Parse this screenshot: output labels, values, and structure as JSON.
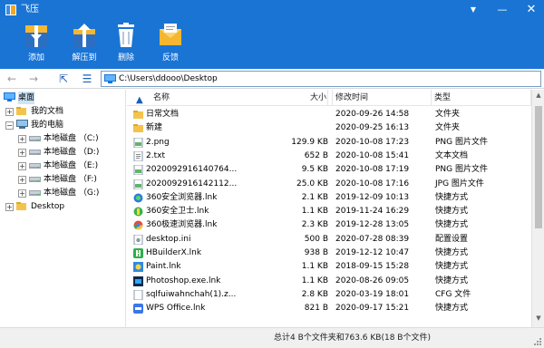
{
  "window": {
    "title": "飞压",
    "menu_icon": "menu-triangle-icon",
    "minimize_icon": "minimize-icon",
    "close_icon": "close-icon"
  },
  "toolbar": {
    "add_label": "添加",
    "extract_label": "解压到",
    "delete_label": "删除",
    "feedback_label": "反馈"
  },
  "nav": {
    "back_icon": "arrow-left-icon",
    "forward_icon": "arrow-right-icon",
    "up_icon": "up-folder-icon",
    "list_icon": "list-view-icon",
    "path": "C:\\Users\\ddooo\\Desktop"
  },
  "tree": [
    {
      "label": "桌面",
      "icon": "desktop-icon",
      "expander": "",
      "selected": true
    },
    {
      "label": "我的文档",
      "icon": "folder-icon",
      "expander": "+"
    },
    {
      "label": "我的电脑",
      "icon": "computer-icon",
      "expander": "−"
    },
    {
      "label": "本地磁盘 （C:)",
      "icon": "drive-icon",
      "expander": "+"
    },
    {
      "label": "本地磁盘 （D:)",
      "icon": "drive-icon",
      "expander": "+"
    },
    {
      "label": "本地磁盘 （E:)",
      "icon": "drive-icon",
      "expander": "+"
    },
    {
      "label": "本地磁盘 （F:)",
      "icon": "drive-icon",
      "expander": "+"
    },
    {
      "label": "本地磁盘 （G:)",
      "icon": "drive-icon",
      "expander": "+"
    },
    {
      "label": "Desktop",
      "icon": "folder-icon",
      "expander": "+"
    }
  ],
  "columns": {
    "name": "名称",
    "size": "大小",
    "mtime": "修改时间",
    "type": "类型"
  },
  "files": [
    {
      "name": "日常文档",
      "size": "",
      "mtime": "2020-09-26 14:58",
      "type": "文件夹",
      "icon": "folder-icon"
    },
    {
      "name": "新建",
      "size": "",
      "mtime": "2020-09-25 16:13",
      "type": "文件夹",
      "icon": "folder-icon"
    },
    {
      "name": "2.png",
      "size": "129.9 KB",
      "mtime": "2020-10-08 17:23",
      "type": "PNG 图片文件",
      "icon": "image-file-icon"
    },
    {
      "name": "2.txt",
      "size": "652 B",
      "mtime": "2020-10-08 15:41",
      "type": "文本文档",
      "icon": "text-file-icon"
    },
    {
      "name": "2020092916140764...",
      "size": "9.5 KB",
      "mtime": "2020-10-08 17:19",
      "type": "PNG 图片文件",
      "icon": "image-file-icon"
    },
    {
      "name": "2020092916142112...",
      "size": "25.0 KB",
      "mtime": "2020-10-08 17:16",
      "type": "JPG 图片文件",
      "icon": "image-file-icon"
    },
    {
      "name": "360安全浏览器.lnk",
      "size": "2.1 KB",
      "mtime": "2019-12-09 10:13",
      "type": "快捷方式",
      "icon": "browser-360-icon"
    },
    {
      "name": "360安全卫士.lnk",
      "size": "1.1 KB",
      "mtime": "2019-11-24 16:29",
      "type": "快捷方式",
      "icon": "shield-360-icon"
    },
    {
      "name": "360极速浏览器.lnk",
      "size": "2.3 KB",
      "mtime": "2019-12-28 13:05",
      "type": "快捷方式",
      "icon": "chrome-like-icon"
    },
    {
      "name": "desktop.ini",
      "size": "500 B",
      "mtime": "2020-07-28 08:39",
      "type": "配置设置",
      "icon": "settings-file-icon"
    },
    {
      "name": "HBuilderX.lnk",
      "size": "938 B",
      "mtime": "2019-12-12 10:47",
      "type": "快捷方式",
      "icon": "hbuilder-icon"
    },
    {
      "name": "Paint.lnk",
      "size": "1.1 KB",
      "mtime": "2018-09-15 15:28",
      "type": "快捷方式",
      "icon": "paint-icon"
    },
    {
      "name": "Photoshop.exe.lnk",
      "size": "1.1 KB",
      "mtime": "2020-08-26 09:05",
      "type": "快捷方式",
      "icon": "photoshop-icon"
    },
    {
      "name": "sqlfuiwahnchah(1).z...",
      "size": "2.8 KB",
      "mtime": "2020-03-19 18:01",
      "type": "CFG 文件",
      "icon": "generic-file-icon"
    },
    {
      "name": "WPS Office.lnk",
      "size": "821 B",
      "mtime": "2020-09-17 15:21",
      "type": "快捷方式",
      "icon": "wps-icon"
    }
  ],
  "status": {
    "text": "总计4 B个文件夹和763.6 KB(18 B个文件)"
  },
  "colors": {
    "ribbon": "#1a74d4",
    "selection": "#cce4f7",
    "accent": "#1a5fb4"
  }
}
